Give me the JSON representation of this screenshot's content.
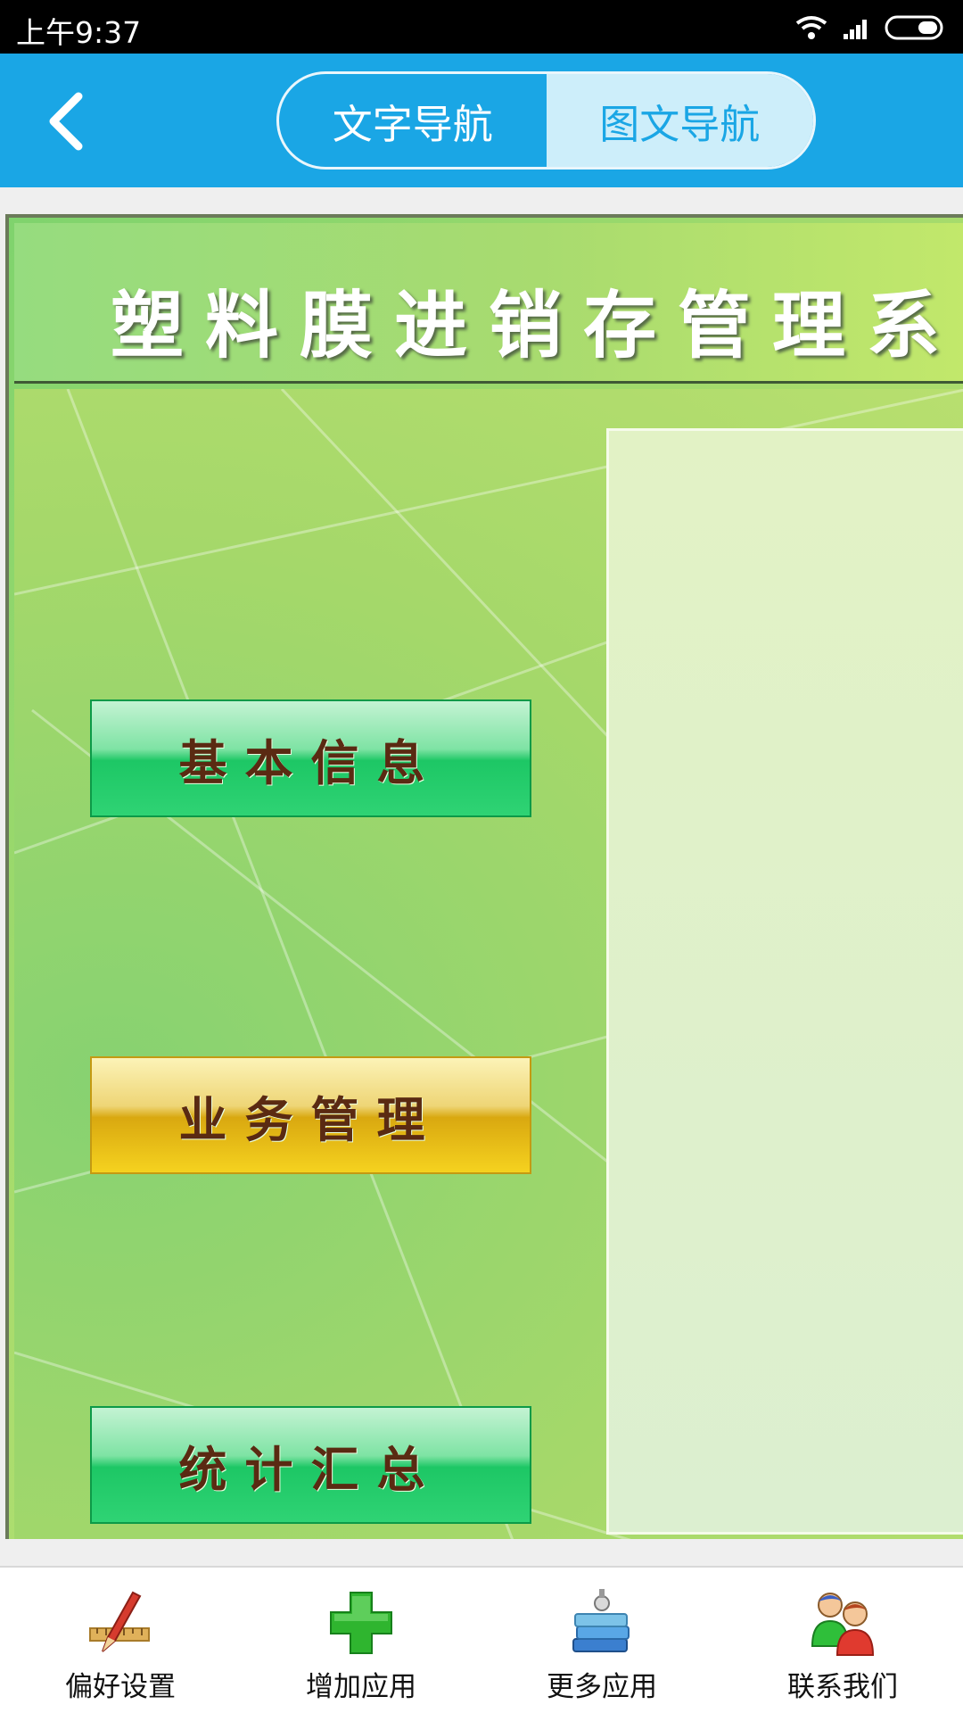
{
  "status_bar": {
    "time": "上午9:37",
    "icons": [
      "wifi-icon",
      "signal-icon",
      "battery-icon"
    ]
  },
  "navbar": {
    "back_icon": "chevron-left-icon",
    "tabs": [
      {
        "label": "文字导航",
        "selected": false
      },
      {
        "label": "图文导航",
        "selected": true
      }
    ],
    "accent_color": "#1aa6e5"
  },
  "main": {
    "system_title": "塑料膜进销存管理系",
    "menu_buttons": [
      {
        "label": "基本信息",
        "color": "green"
      },
      {
        "label": "业务管理",
        "color": "yellow"
      },
      {
        "label": "统计汇总",
        "color": "green"
      }
    ]
  },
  "bottom_bar": {
    "items": [
      {
        "label": "偏好设置",
        "icon": "ruler-pencil-icon"
      },
      {
        "label": "增加应用",
        "icon": "plus-icon"
      },
      {
        "label": "更多应用",
        "icon": "books-icon"
      },
      {
        "label": "联系我们",
        "icon": "users-icon"
      }
    ]
  }
}
